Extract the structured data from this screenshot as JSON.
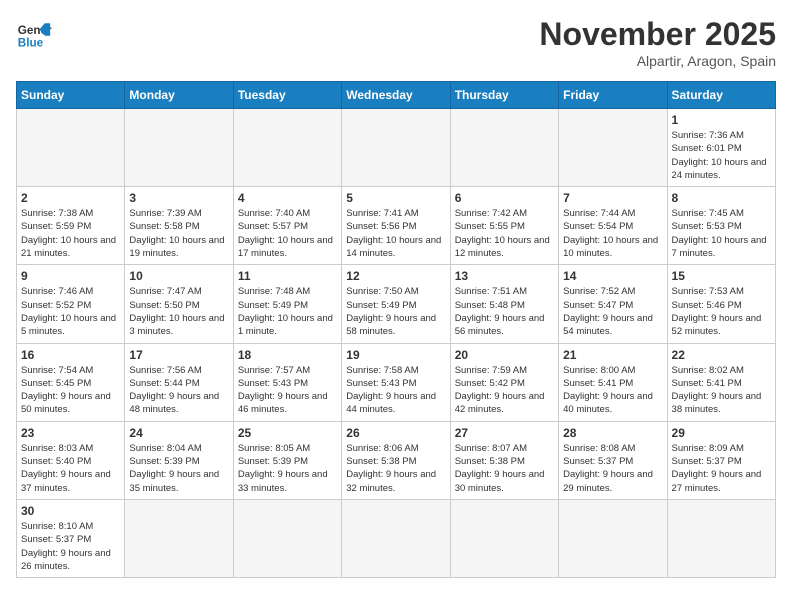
{
  "header": {
    "logo_general": "General",
    "logo_blue": "Blue",
    "month_title": "November 2025",
    "location": "Alpartir, Aragon, Spain"
  },
  "days_of_week": [
    "Sunday",
    "Monday",
    "Tuesday",
    "Wednesday",
    "Thursday",
    "Friday",
    "Saturday"
  ],
  "weeks": [
    [
      {
        "day": "",
        "info": ""
      },
      {
        "day": "",
        "info": ""
      },
      {
        "day": "",
        "info": ""
      },
      {
        "day": "",
        "info": ""
      },
      {
        "day": "",
        "info": ""
      },
      {
        "day": "",
        "info": ""
      },
      {
        "day": "1",
        "info": "Sunrise: 7:36 AM\nSunset: 6:01 PM\nDaylight: 10 hours and 24 minutes."
      }
    ],
    [
      {
        "day": "2",
        "info": "Sunrise: 7:38 AM\nSunset: 5:59 PM\nDaylight: 10 hours and 21 minutes."
      },
      {
        "day": "3",
        "info": "Sunrise: 7:39 AM\nSunset: 5:58 PM\nDaylight: 10 hours and 19 minutes."
      },
      {
        "day": "4",
        "info": "Sunrise: 7:40 AM\nSunset: 5:57 PM\nDaylight: 10 hours and 17 minutes."
      },
      {
        "day": "5",
        "info": "Sunrise: 7:41 AM\nSunset: 5:56 PM\nDaylight: 10 hours and 14 minutes."
      },
      {
        "day": "6",
        "info": "Sunrise: 7:42 AM\nSunset: 5:55 PM\nDaylight: 10 hours and 12 minutes."
      },
      {
        "day": "7",
        "info": "Sunrise: 7:44 AM\nSunset: 5:54 PM\nDaylight: 10 hours and 10 minutes."
      },
      {
        "day": "8",
        "info": "Sunrise: 7:45 AM\nSunset: 5:53 PM\nDaylight: 10 hours and 7 minutes."
      }
    ],
    [
      {
        "day": "9",
        "info": "Sunrise: 7:46 AM\nSunset: 5:52 PM\nDaylight: 10 hours and 5 minutes."
      },
      {
        "day": "10",
        "info": "Sunrise: 7:47 AM\nSunset: 5:50 PM\nDaylight: 10 hours and 3 minutes."
      },
      {
        "day": "11",
        "info": "Sunrise: 7:48 AM\nSunset: 5:49 PM\nDaylight: 10 hours and 1 minute."
      },
      {
        "day": "12",
        "info": "Sunrise: 7:50 AM\nSunset: 5:49 PM\nDaylight: 9 hours and 58 minutes."
      },
      {
        "day": "13",
        "info": "Sunrise: 7:51 AM\nSunset: 5:48 PM\nDaylight: 9 hours and 56 minutes."
      },
      {
        "day": "14",
        "info": "Sunrise: 7:52 AM\nSunset: 5:47 PM\nDaylight: 9 hours and 54 minutes."
      },
      {
        "day": "15",
        "info": "Sunrise: 7:53 AM\nSunset: 5:46 PM\nDaylight: 9 hours and 52 minutes."
      }
    ],
    [
      {
        "day": "16",
        "info": "Sunrise: 7:54 AM\nSunset: 5:45 PM\nDaylight: 9 hours and 50 minutes."
      },
      {
        "day": "17",
        "info": "Sunrise: 7:56 AM\nSunset: 5:44 PM\nDaylight: 9 hours and 48 minutes."
      },
      {
        "day": "18",
        "info": "Sunrise: 7:57 AM\nSunset: 5:43 PM\nDaylight: 9 hours and 46 minutes."
      },
      {
        "day": "19",
        "info": "Sunrise: 7:58 AM\nSunset: 5:43 PM\nDaylight: 9 hours and 44 minutes."
      },
      {
        "day": "20",
        "info": "Sunrise: 7:59 AM\nSunset: 5:42 PM\nDaylight: 9 hours and 42 minutes."
      },
      {
        "day": "21",
        "info": "Sunrise: 8:00 AM\nSunset: 5:41 PM\nDaylight: 9 hours and 40 minutes."
      },
      {
        "day": "22",
        "info": "Sunrise: 8:02 AM\nSunset: 5:41 PM\nDaylight: 9 hours and 38 minutes."
      }
    ],
    [
      {
        "day": "23",
        "info": "Sunrise: 8:03 AM\nSunset: 5:40 PM\nDaylight: 9 hours and 37 minutes."
      },
      {
        "day": "24",
        "info": "Sunrise: 8:04 AM\nSunset: 5:39 PM\nDaylight: 9 hours and 35 minutes."
      },
      {
        "day": "25",
        "info": "Sunrise: 8:05 AM\nSunset: 5:39 PM\nDaylight: 9 hours and 33 minutes."
      },
      {
        "day": "26",
        "info": "Sunrise: 8:06 AM\nSunset: 5:38 PM\nDaylight: 9 hours and 32 minutes."
      },
      {
        "day": "27",
        "info": "Sunrise: 8:07 AM\nSunset: 5:38 PM\nDaylight: 9 hours and 30 minutes."
      },
      {
        "day": "28",
        "info": "Sunrise: 8:08 AM\nSunset: 5:37 PM\nDaylight: 9 hours and 29 minutes."
      },
      {
        "day": "29",
        "info": "Sunrise: 8:09 AM\nSunset: 5:37 PM\nDaylight: 9 hours and 27 minutes."
      }
    ],
    [
      {
        "day": "30",
        "info": "Sunrise: 8:10 AM\nSunset: 5:37 PM\nDaylight: 9 hours and 26 minutes."
      },
      {
        "day": "",
        "info": ""
      },
      {
        "day": "",
        "info": ""
      },
      {
        "day": "",
        "info": ""
      },
      {
        "day": "",
        "info": ""
      },
      {
        "day": "",
        "info": ""
      },
      {
        "day": "",
        "info": ""
      }
    ]
  ]
}
